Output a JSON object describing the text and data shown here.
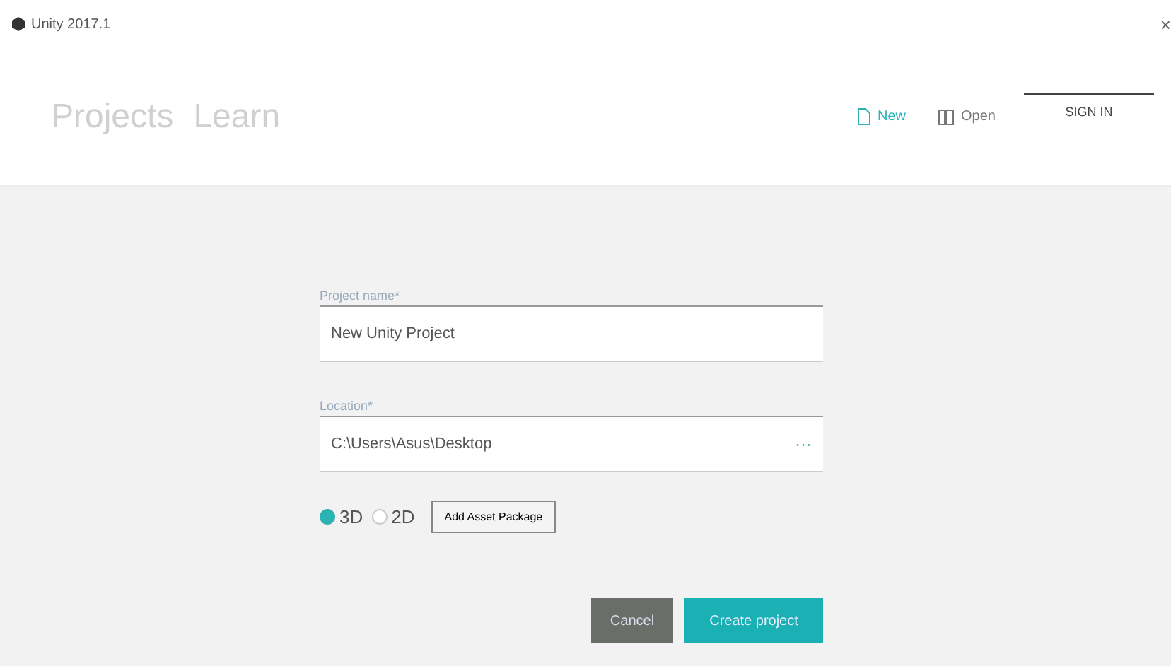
{
  "window": {
    "title": "Unity 2017.1",
    "close": "×"
  },
  "tabs": [
    {
      "label": "Projects",
      "selected": false
    },
    {
      "label": "Learn",
      "selected": false
    }
  ],
  "toolbar": {
    "new": "New",
    "open": "Open",
    "account": "SIGN IN"
  },
  "form": {
    "fields": [
      {
        "label": "Project name*",
        "value": "New Unity Project"
      },
      {
        "label": "Location*",
        "value": "C:\\Users\\Asus\\Desktop",
        "browse": "···"
      }
    ],
    "templates": [
      {
        "label": "3D",
        "selected": true
      },
      {
        "label": "2D",
        "selected": false
      }
    ],
    "asset_button": "Add Asset Package",
    "cancel": "Cancel",
    "create": "Create project"
  }
}
